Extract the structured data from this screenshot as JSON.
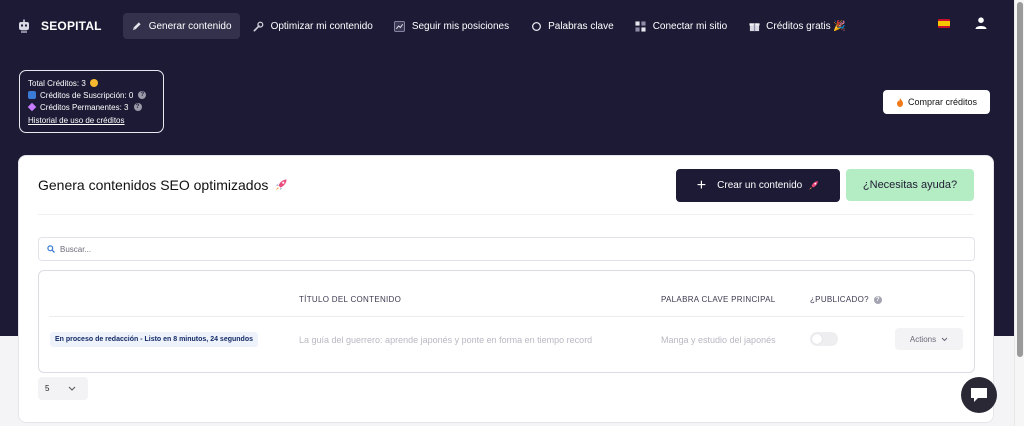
{
  "brand": {
    "name": "SEOPITAL",
    "logo_icon": "robot-logo"
  },
  "nav": {
    "items": [
      {
        "label": "Generar contenido",
        "icon": "pencil-icon",
        "active": true
      },
      {
        "label": "Optimizar mi contenido",
        "icon": "wrench-icon",
        "active": false
      },
      {
        "label": "Seguir mis posiciones",
        "icon": "chart-icon",
        "active": false
      },
      {
        "label": "Palabras clave",
        "icon": "magnifier-icon",
        "active": false
      },
      {
        "label": "Conectar mi sitio",
        "icon": "qr-icon",
        "active": false
      },
      {
        "label": "Créditos gratis 🎉",
        "icon": "gift-icon",
        "active": false
      }
    ],
    "language_flag": "spain-flag",
    "user_icon": "user-icon"
  },
  "credits": {
    "total": "Total Créditos: 3",
    "subscription": "Créditos de Suscripción: 0",
    "permanent": "Créditos Permanentes: 3",
    "history_link": "Historial de uso de créditos"
  },
  "buy_button": "Comprar créditos",
  "main": {
    "title": "Genera contenidos SEO optimizados",
    "create_button": "Crear un contenido",
    "help_button": "¿Necesitas ayuda?",
    "search_placeholder": "Buscar...",
    "table": {
      "headers": {
        "title": "TÍTULO DEL CONTENIDO",
        "keyword": "PALABRA CLAVE PRINCIPAL",
        "published": "¿PUBLICADO?"
      },
      "rows": [
        {
          "status": "En proceso de redacción  - Listo en 8 minutos, 24 segundos",
          "title": "La guía del guerrero: aprende japonés y ponte en forma en tiempo record",
          "keyword": "Manga y estudio del japonés",
          "published": false,
          "actions": "Actions"
        }
      ]
    },
    "page_size": "5"
  },
  "colors": {
    "hero_bg": "#1d1a35",
    "help_button_bg": "#b4ecc4",
    "create_button_bg": "#1d1a35"
  }
}
